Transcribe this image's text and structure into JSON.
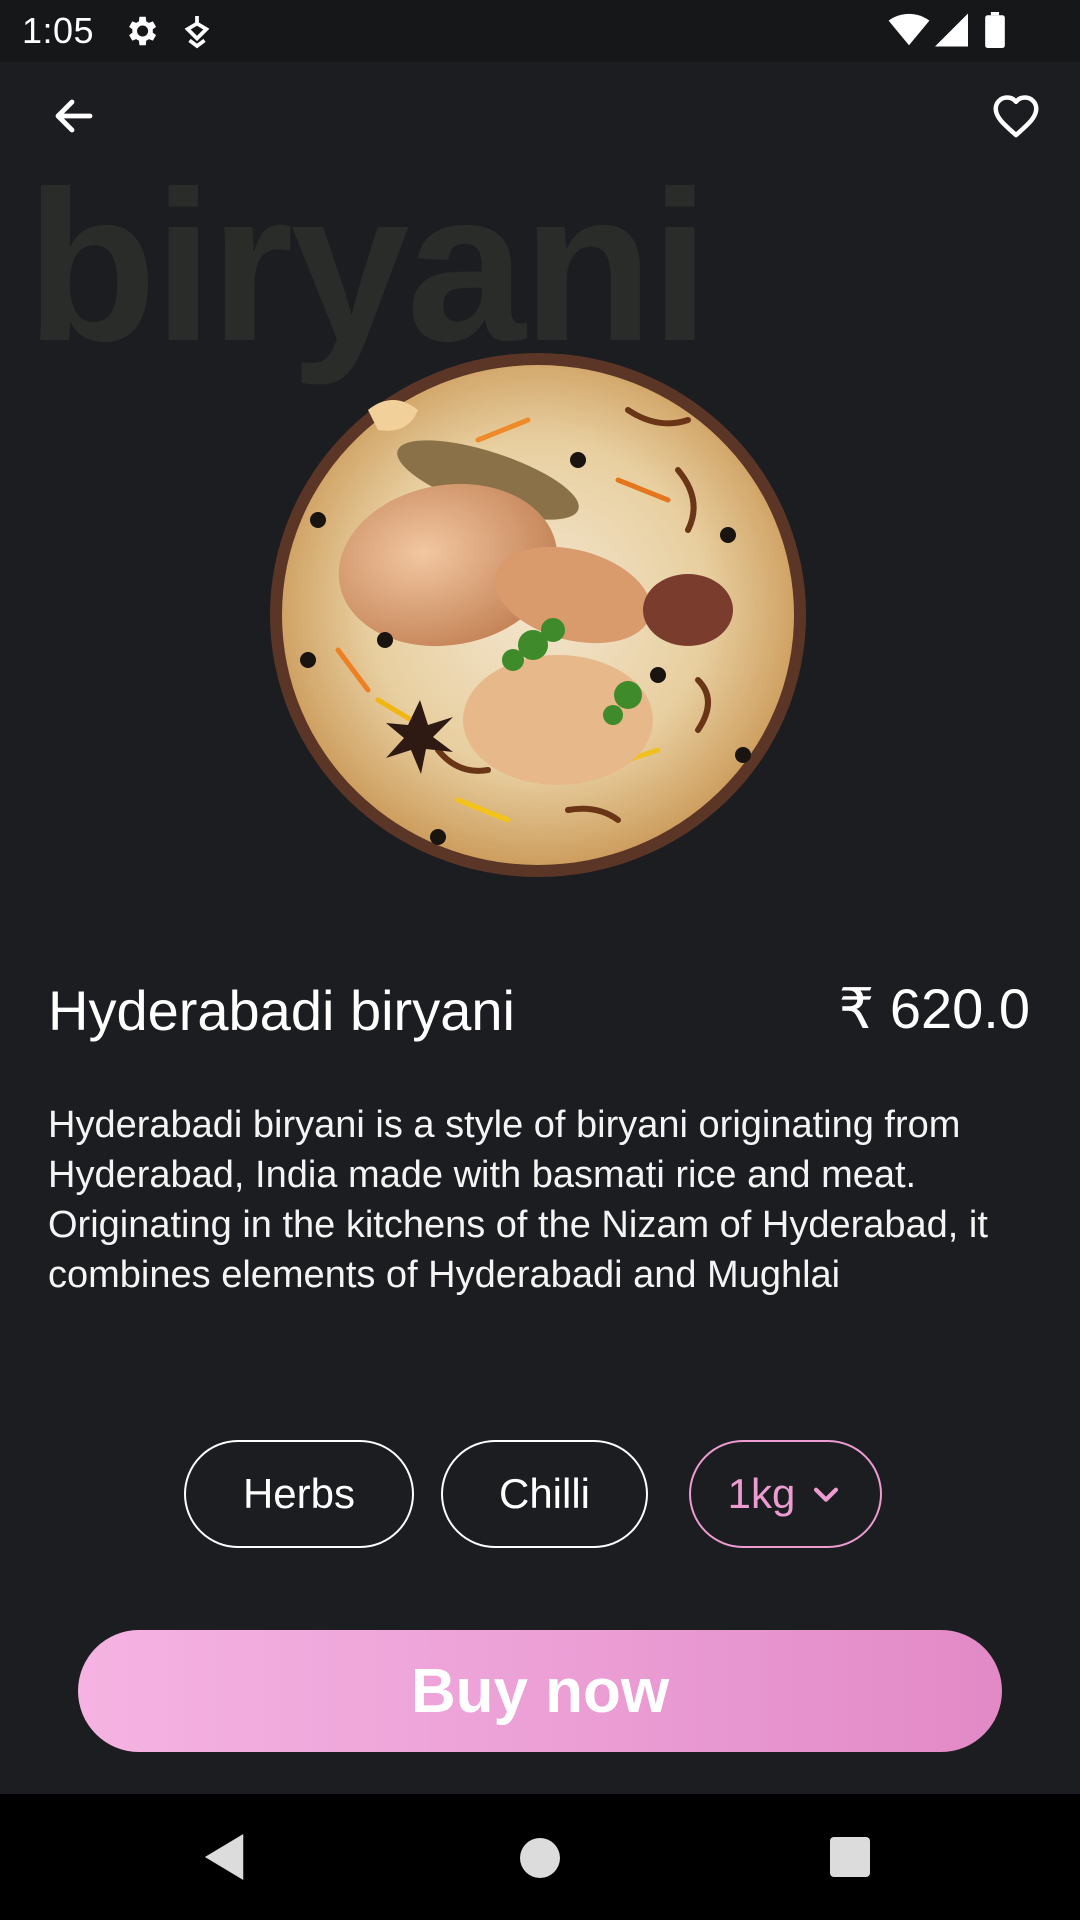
{
  "status_bar": {
    "time": "1:05",
    "icons": [
      "gear-icon",
      "tag-icon",
      "wifi-icon",
      "signal-icon",
      "battery-icon"
    ]
  },
  "app_bar": {
    "back_icon": "arrow-left-icon",
    "favorite_icon": "heart-outline-icon"
  },
  "watermark": "biryani",
  "product": {
    "title": "Hyderabadi biryani",
    "price": "₹ 620.0",
    "description": "Hyderabadi biryani is a style of biryani originating from Hyderabad, India made with basmati rice and meat. Originating in the kitchens of the Nizam of Hyderabad, it combines elements of Hyderabadi and Mughlai"
  },
  "options": {
    "herbs": "Herbs",
    "chilli": "Chilli",
    "size": "1kg"
  },
  "buy_button": "Buy now",
  "colors": {
    "background": "#1c1d21",
    "accent_pink": "#ec9cd0",
    "button_gradient_start": "#f5b3e2",
    "button_gradient_end": "#e289c6"
  },
  "nav_bar": {
    "icons": [
      "nav-back-icon",
      "nav-home-icon",
      "nav-recents-icon"
    ]
  }
}
